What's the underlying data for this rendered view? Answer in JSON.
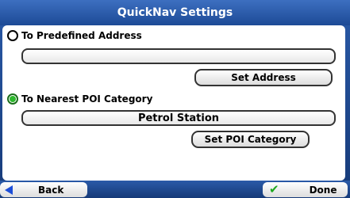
{
  "title": "QuickNav Settings",
  "option_address": {
    "label": "To Predefined Address",
    "selected": false,
    "value": "",
    "button_label": "Set Address"
  },
  "option_poi": {
    "label": "To Nearest POI Category",
    "selected": true,
    "value": "Petrol Station",
    "button_label": "Set POI Category"
  },
  "bottom": {
    "back_label": "Back",
    "done_label": "Done"
  },
  "icons": {
    "back": "left-arrow-icon",
    "done": "checkmark-icon",
    "radio": "radio-icon"
  },
  "colors": {
    "header_bg": "#2a5aa8",
    "radio_selected": "#2db82d",
    "back_arrow": "#1d4ed8",
    "done_check": "#1fa81f"
  }
}
